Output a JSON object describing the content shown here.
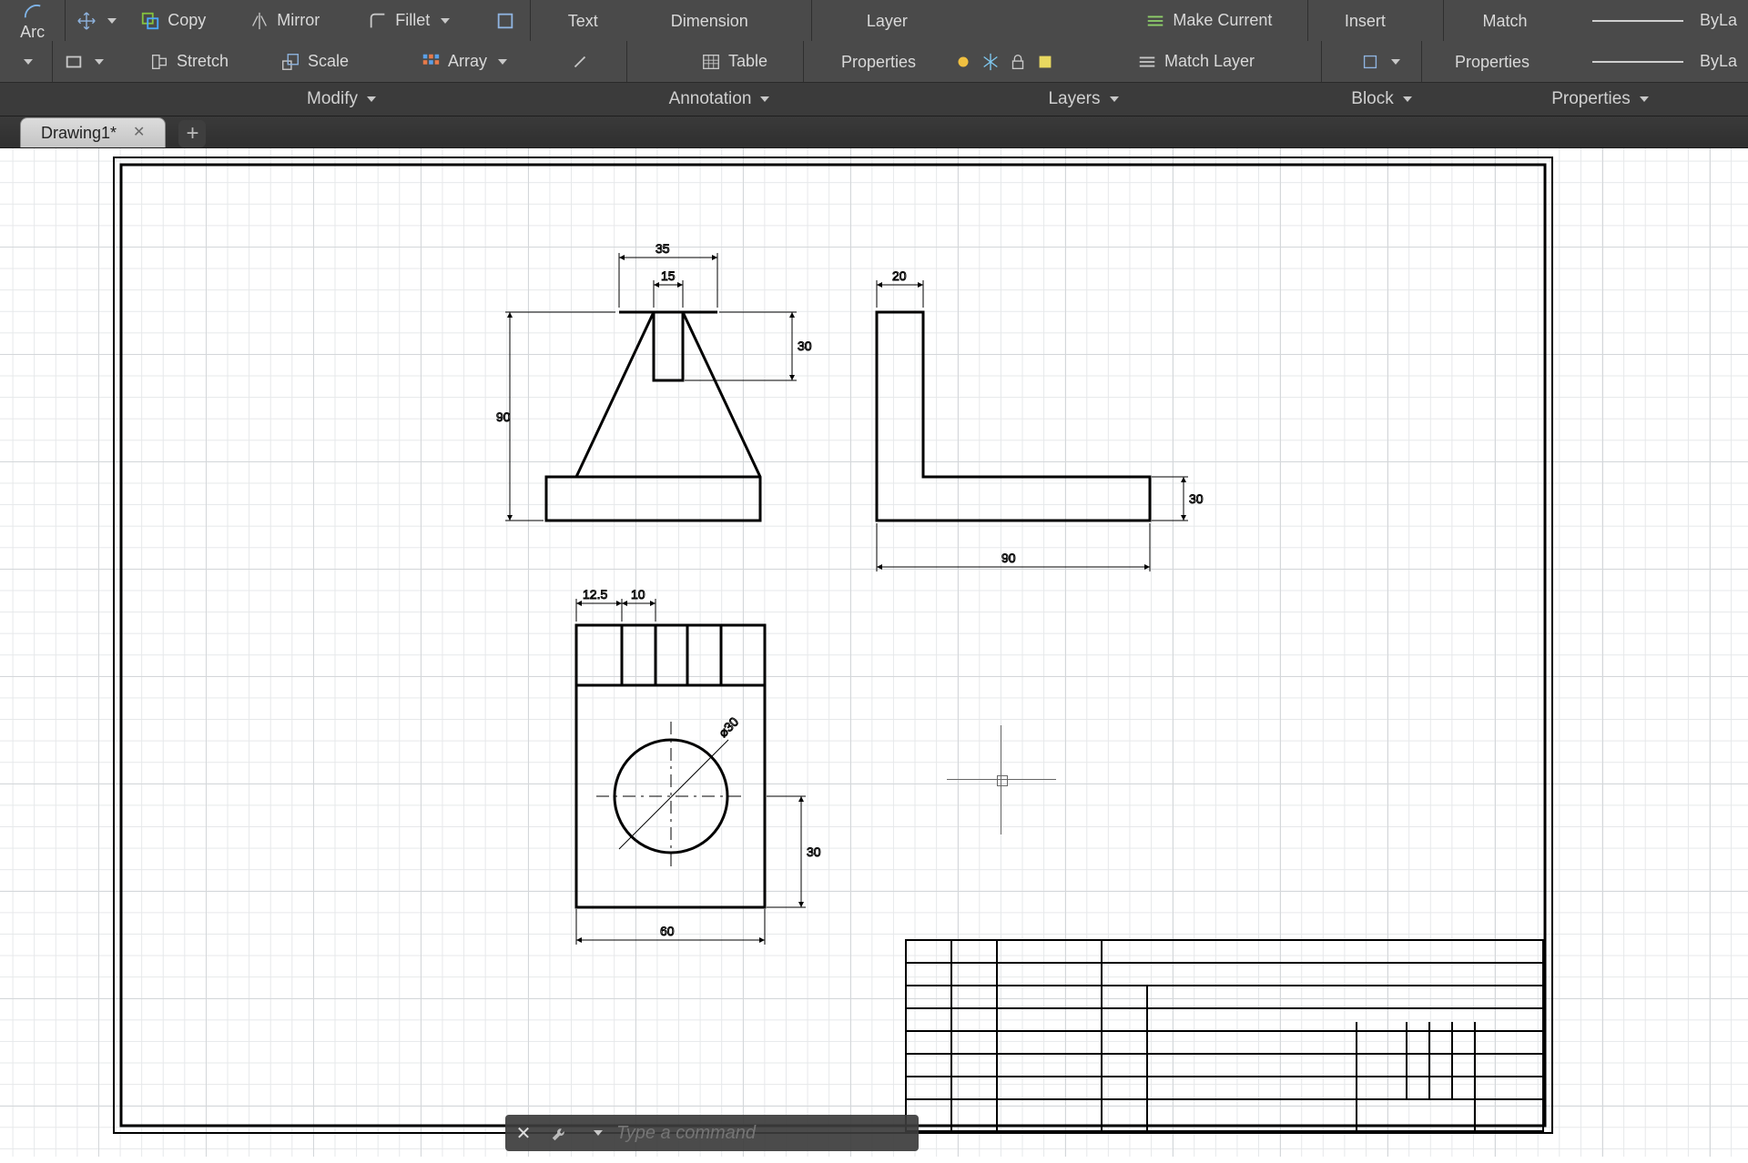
{
  "ribbon": {
    "draw": {
      "arc": "Arc"
    },
    "modify": {
      "copy": "Copy",
      "mirror": "Mirror",
      "fillet": "Fillet",
      "stretch": "Stretch",
      "scale": "Scale",
      "array": "Array",
      "panel": "Modify"
    },
    "annot": {
      "text": "Text",
      "dimension": "Dimension",
      "table": "Table",
      "panel": "Annotation"
    },
    "layers": {
      "layer": "Layer",
      "properties": "Properties",
      "makecurrent": "Make Current",
      "matchlayer": "Match Layer",
      "panel": "Layers"
    },
    "block": {
      "insert": "Insert",
      "panel": "Block"
    },
    "props": {
      "match": "Match",
      "properties": "Properties",
      "bylayer": "ByLa",
      "panel": "Properties"
    }
  },
  "tab": {
    "name": "Drawing1*",
    "close": "✕",
    "add": "+"
  },
  "cmd": {
    "close": "✕",
    "placeholder": "Type a command"
  },
  "dims": {
    "front_top_outer": "35",
    "front_top_inner": "15",
    "front_slot_h": "30",
    "front_total_h": "90",
    "side_top_w": "20",
    "side_base_h": "30",
    "side_base_w": "90",
    "plan_a": "12.5",
    "plan_b": "10",
    "plan_w": "60",
    "plan_side": "30",
    "circle": "⌀30"
  }
}
